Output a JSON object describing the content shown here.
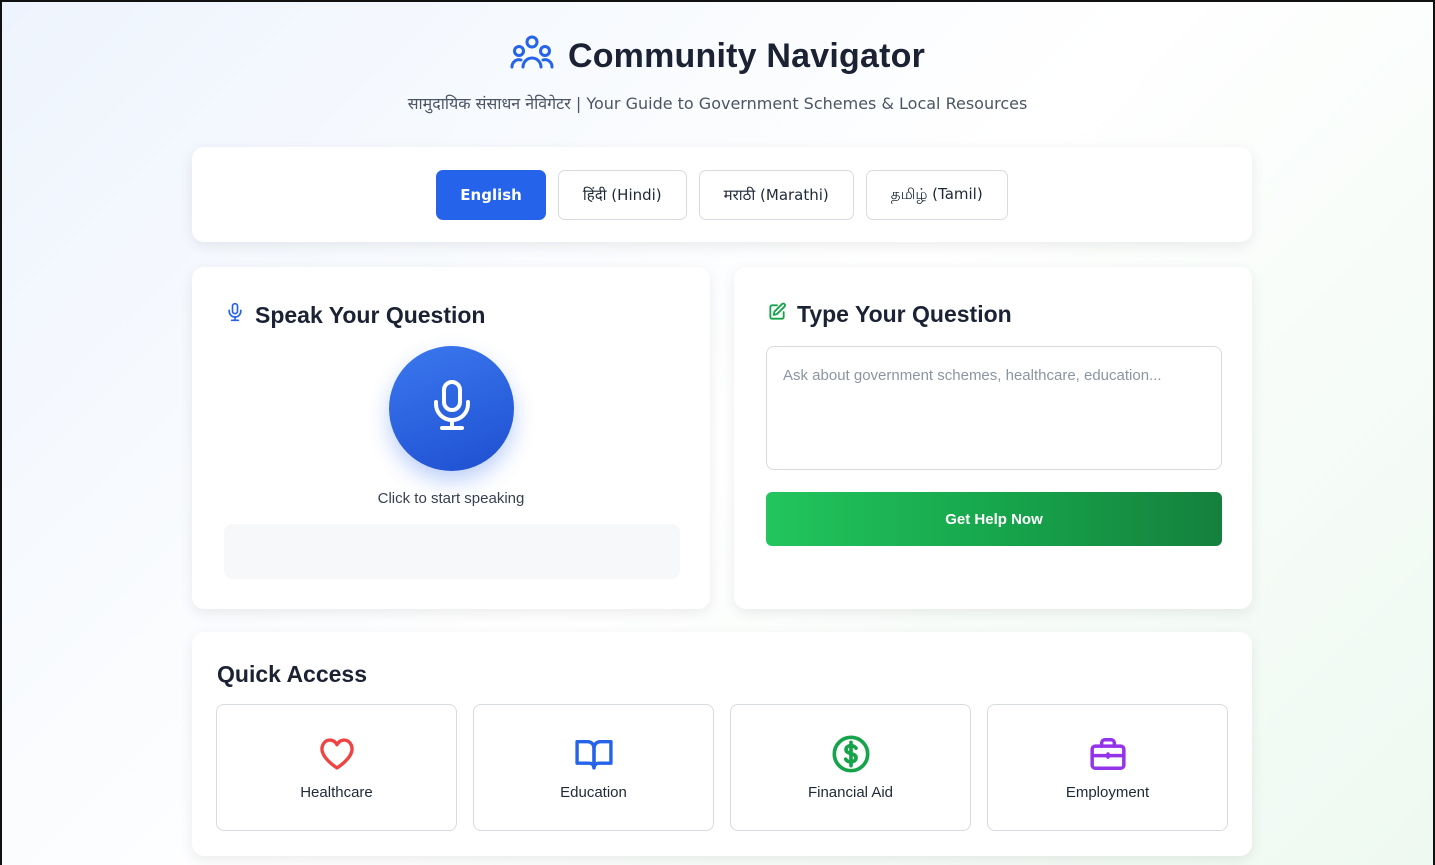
{
  "header": {
    "title": "Community Navigator",
    "subtitle": "सामुदायिक संसाधन नेविगेटर | Your Guide to Government Schemes & Local Resources",
    "icon": "users-icon"
  },
  "languages": [
    {
      "label": "English",
      "active": true
    },
    {
      "label": "हिंदी (Hindi)",
      "active": false
    },
    {
      "label": "मराठी (Marathi)",
      "active": false
    },
    {
      "label": "தமிழ் (Tamil)",
      "active": false
    }
  ],
  "speak": {
    "title": "Speak Your Question",
    "hint": "Click to start speaking",
    "transcript": "",
    "icon": "microphone-icon"
  },
  "type": {
    "title": "Type Your Question",
    "placeholder": "Ask about government schemes, healthcare, education...",
    "value": "",
    "button_label": "Get Help Now",
    "icon": "edit-icon"
  },
  "quick_access": {
    "title": "Quick Access",
    "items": [
      {
        "label": "Healthcare",
        "icon": "heart-icon",
        "color": "#ef4444"
      },
      {
        "label": "Education",
        "icon": "book-icon",
        "color": "#2563eb"
      },
      {
        "label": "Financial Aid",
        "icon": "dollar-icon",
        "color": "#16a34a"
      },
      {
        "label": "Employment",
        "icon": "briefcase-icon",
        "color": "#9333ea"
      }
    ]
  },
  "colors": {
    "primary": "#2563eb",
    "success": "#16a34a",
    "heading": "#1a2233"
  }
}
